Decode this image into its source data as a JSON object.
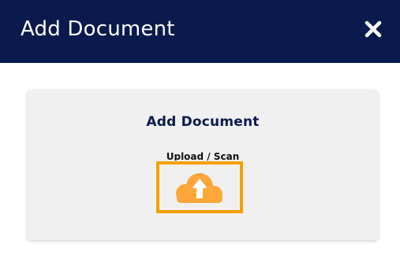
{
  "header": {
    "title": "Add Document",
    "close_icon": "close-icon"
  },
  "card": {
    "title": "Add Document",
    "upload_label": "Upload / Scan",
    "upload_icon": "cloud-upload-icon"
  },
  "colors": {
    "header_bg": "#0b1a4d",
    "card_bg": "#f0f0f0",
    "accent_orange": "#f5a000",
    "cloud_orange": "#ffa63a"
  }
}
